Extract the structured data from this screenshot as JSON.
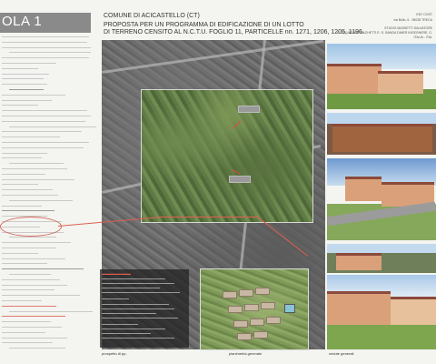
{
  "left": {
    "tab_label": "OLA 1"
  },
  "header": {
    "line1": "COMUNE DI ACICASTELLO (CT)",
    "line2": "PROPOSTA PER UN PROGRAMMA DI EDIFICAZIONE DI UN LOTTO",
    "line3": "DI TERRENO CENSITO AL N.C.T.U. FOGLIO 11, PARTICELLE nn. 1271, 1206, 1205, 1196."
  },
  "right_header": {
    "l1": "ENT COST",
    "l2": "via Bullo, 6 - 95028 TRECA",
    "l3": "STUDIO MASSETTI SALVATORE",
    "l4": "A. SALVATORE MACHETTI E. G. BANDA DIMER INGEGNERE, G.",
    "l5": "ITALIA - ITAL"
  },
  "captions": {
    "aerial": "prospetto di pp.",
    "plan": "planimetria generale",
    "render": "vedute generali"
  },
  "callouts": {
    "top": "area d'intervento",
    "mid": "via Etna"
  }
}
